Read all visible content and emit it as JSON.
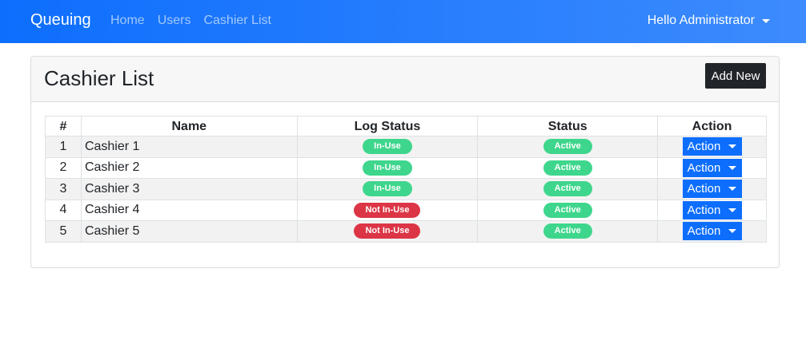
{
  "navbar": {
    "brand": "Queuing",
    "links": [
      {
        "label": "Home"
      },
      {
        "label": "Users"
      },
      {
        "label": "Cashier List"
      }
    ],
    "user_menu": "Hello Administrator"
  },
  "page": {
    "title": "Cashier List",
    "add_button": "Add New"
  },
  "table": {
    "headers": [
      "#",
      "Name",
      "Log Status",
      "Status",
      "Action"
    ],
    "action_label": "Action",
    "rows": [
      {
        "num": "1",
        "name": "Cashier 1",
        "log_status": "In-Use",
        "log_color": "#3ed68c",
        "status": "Active",
        "status_color": "#3ed68c"
      },
      {
        "num": "2",
        "name": "Cashier 2",
        "log_status": "In-Use",
        "log_color": "#3ed68c",
        "status": "Active",
        "status_color": "#3ed68c"
      },
      {
        "num": "3",
        "name": "Cashier 3",
        "log_status": "In-Use",
        "log_color": "#3ed68c",
        "status": "Active",
        "status_color": "#3ed68c"
      },
      {
        "num": "4",
        "name": "Cashier 4",
        "log_status": "Not In-Use",
        "log_color": "#dc3545",
        "status": "Active",
        "status_color": "#3ed68c"
      },
      {
        "num": "5",
        "name": "Cashier 5",
        "log_status": "Not In-Use",
        "log_color": "#dc3545",
        "status": "Active",
        "status_color": "#3ed68c"
      }
    ]
  },
  "colors": {
    "navbar_start": "#0d6efd",
    "navbar_end": "#3d8bfd",
    "primary": "#0d6efd",
    "dark_button": "#212529",
    "success": "#3ed68c",
    "danger": "#dc3545"
  }
}
